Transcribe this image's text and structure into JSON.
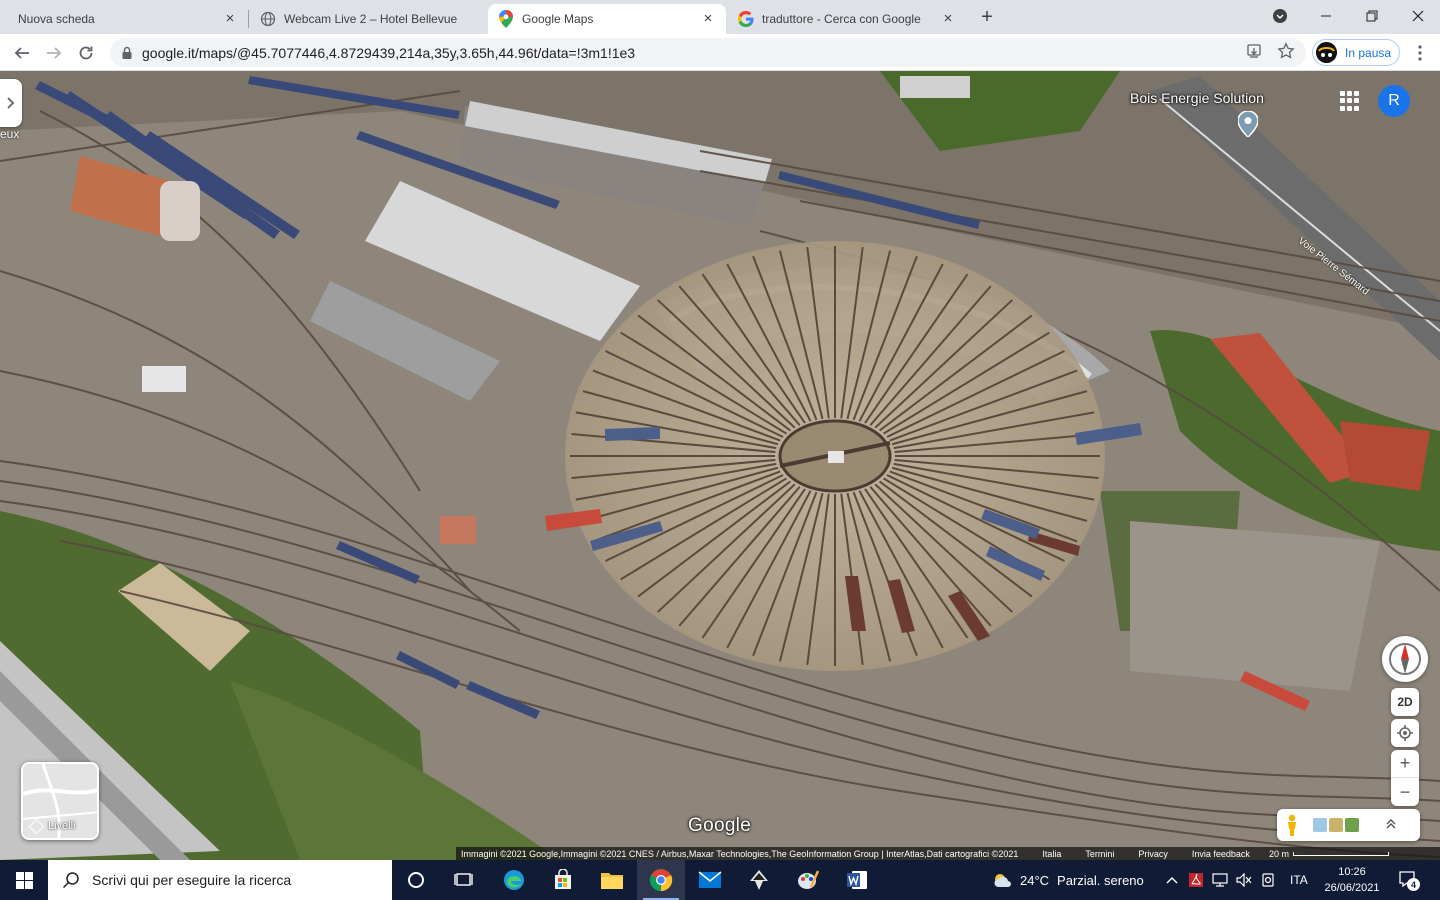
{
  "browser": {
    "tabs": [
      {
        "title": "Nuova scheda",
        "active": false
      },
      {
        "title": "Webcam Live 2 – Hotel Bellevue",
        "active": false
      },
      {
        "title": "Google Maps",
        "active": true
      },
      {
        "title": "traduttore - Cerca con Google",
        "active": false
      }
    ],
    "new_tab_symbol": "+",
    "close_symbol": "×",
    "url": "google.it/maps/@45.7077446,4.8729439,214a,35y,3.65h,44.96t/data=!3m1!1e3",
    "profile_status": "In pausa"
  },
  "map": {
    "place_label": "Bois Energie Solution",
    "edge_label": "eux",
    "road_label": "Voie Pierre Sémard",
    "account_initial": "R",
    "layers_label": "Livelli",
    "view_toggle": "2D",
    "zoom_in": "+",
    "zoom_out": "−",
    "google_logo": "Google",
    "attribution": "Immagini ©2021 Google,Immagini ©2021 CNES / Airbus,Maxar Technologies,The GeoInformation Group | InterAtlas,Dati cartografici ©2021",
    "footer_links": [
      "Italia",
      "Termini",
      "Privacy",
      "Invia feedback"
    ],
    "scale_label": "20 m",
    "colors": {
      "turntable_ground": "#b9a98f",
      "rail": "#5a4a3e",
      "roof": "#c9c9c9",
      "vegetation": "#4f6b2f"
    }
  },
  "taskbar": {
    "search_placeholder": "Scrivi qui per eseguire la ricerca",
    "temperature": "24°C",
    "weather_text": "Parzial. sereno",
    "language": "ITA",
    "time": "10:26",
    "date": "26/06/2021",
    "notification_count": "4"
  }
}
